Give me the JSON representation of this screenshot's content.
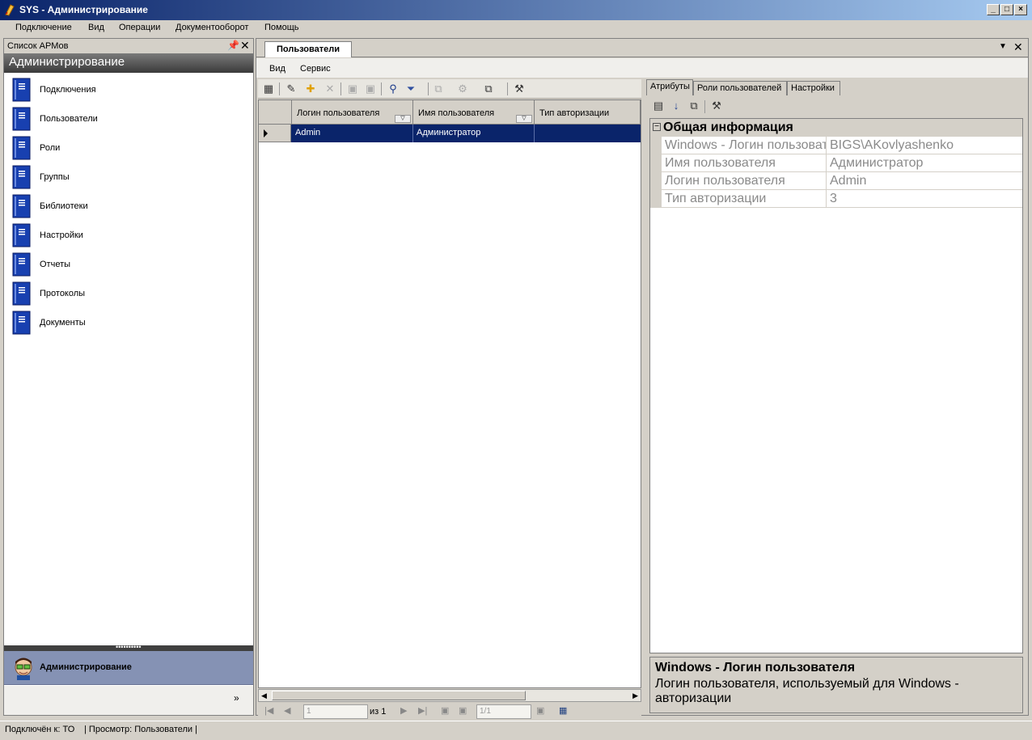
{
  "window": {
    "title": "SYS - Администрирование"
  },
  "menu": [
    "Подключение",
    "Вид",
    "Операции",
    "Документооборот",
    "Помощь"
  ],
  "left_panel": {
    "header": "Список АРМов",
    "banner": "Администрирование",
    "items": [
      "Подключения",
      "Пользователи",
      "Роли",
      "Группы",
      "Библиотеки",
      "Настройки",
      "Отчеты",
      "Протоколы",
      "Документы"
    ],
    "active_workspace": "Администрирование",
    "more_glyph": "»"
  },
  "document": {
    "tab": "Пользователи",
    "menu": [
      "Вид",
      "Сервис"
    ]
  },
  "grid": {
    "columns": [
      "Логин пользователя",
      "Имя пользователя",
      "Тип авторизации"
    ],
    "rows": [
      {
        "login": "Admin",
        "name": "Администратор",
        "auth": ""
      }
    ],
    "nav": {
      "page": "1",
      "of": "из 1",
      "pos": "1/1"
    }
  },
  "properties": {
    "tabs": [
      "Атрибуты",
      "Роли пользователей",
      "Настройки"
    ],
    "category": "Общая информация",
    "rows": [
      {
        "key": "Windows - Логин пользователя",
        "value": "BIGS\\AKovlyashenko"
      },
      {
        "key": "Имя пользователя",
        "value": "Администратор"
      },
      {
        "key": "Логин пользователя",
        "value": "Admin"
      },
      {
        "key": "Тип авторизации",
        "value": "3"
      }
    ],
    "description_title": "Windows - Логин пользователя",
    "description_text": "Логин пользователя, используемый для Windows - авторизации"
  },
  "status": {
    "connected": "Подключён к: ТО",
    "view": "| Просмотр: Пользователи |"
  }
}
